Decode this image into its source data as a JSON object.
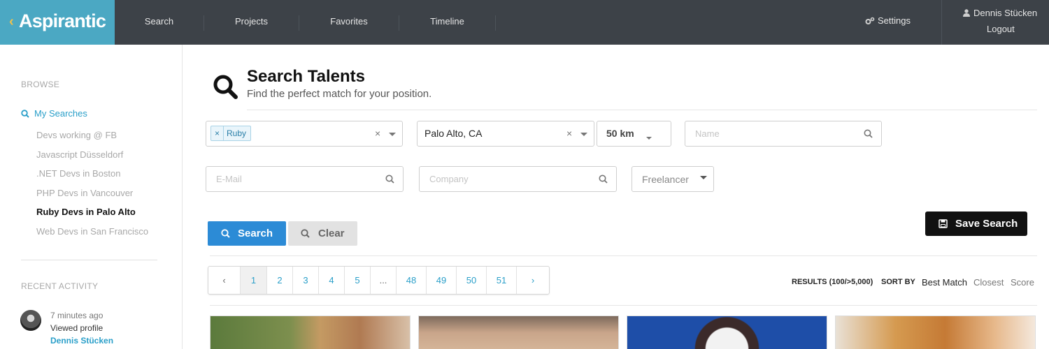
{
  "app": {
    "logo_text": "Aspirantic",
    "logo_chevron": "‹"
  },
  "nav": {
    "items": [
      "Search",
      "Projects",
      "Favorites",
      "Timeline"
    ],
    "settings_label": "Settings",
    "user_name": "Dennis Stücken",
    "logout_label": "Logout"
  },
  "sidebar": {
    "browse_heading": "BROWSE",
    "my_searches_label": "My Searches",
    "saved_searches": [
      "Devs working @ FB",
      "Javascript Düsseldorf",
      ".NET Devs in Boston",
      "PHP Devs in Vancouver",
      "Ruby Devs in Palo Alto",
      "Web Devs in San Francisco"
    ],
    "active_index": 4,
    "recent_activity_heading": "RECENT ACTIVITY",
    "activity": {
      "time": "7 minutes ago",
      "text": "Viewed profile",
      "name": "Dennis Stücken"
    }
  },
  "page": {
    "title": "Search Talents",
    "subtitle": "Find the perfect match for your position."
  },
  "filters": {
    "skills_tag": "Ruby",
    "location_value": "Palo Alto, CA",
    "radius_value": "50 km",
    "name_placeholder": "Name",
    "email_placeholder": "E-Mail",
    "company_placeholder": "Company",
    "type_value": "Freelancer"
  },
  "actions": {
    "search_label": "Search",
    "clear_label": "Clear",
    "save_label": "Save Search"
  },
  "pagination": {
    "prev": "‹",
    "pages": [
      "1",
      "2",
      "3",
      "4",
      "5",
      "...",
      "48",
      "49",
      "50",
      "51"
    ],
    "next": "›",
    "current": "1"
  },
  "results": {
    "count_label": "RESULTS (100/>5,000)",
    "sort_label": "SORT BY",
    "sort_options": [
      "Best Match",
      "Closest",
      "Score"
    ],
    "active_sort": "Best Match"
  },
  "colors": {
    "accent": "#2a9fc9",
    "primary_button": "#2c8bd6",
    "topbar": "#3d4248",
    "logo_bg": "#4ba8c3"
  }
}
